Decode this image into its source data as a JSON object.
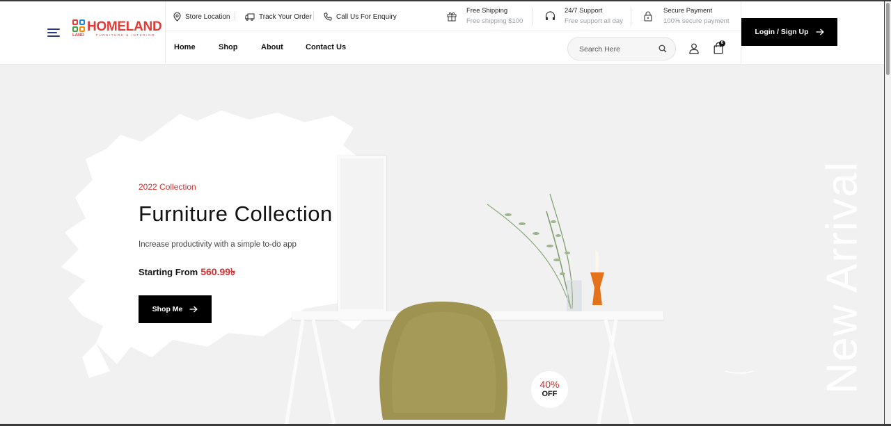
{
  "header": {
    "logo": {
      "name": "HOMELAND",
      "sub": "LAND",
      "tagline": "FURNITURE & INTERIOR"
    },
    "top_links": [
      {
        "label": "Store Location",
        "icon": "location-pin-icon"
      },
      {
        "label": "Track Your Order",
        "icon": "truck-icon"
      },
      {
        "label": "Call Us For Enquiry",
        "icon": "phone-icon"
      }
    ],
    "features": [
      {
        "title": "Free Shipping",
        "sub": "Free shipping $100",
        "icon": "gift-icon"
      },
      {
        "title": "24/7 Support",
        "sub": "Free support all day",
        "icon": "headphones-icon"
      },
      {
        "title": "Secure Payment",
        "sub": "100% secure payment",
        "icon": "lock-icon"
      }
    ],
    "nav": [
      {
        "label": "Home"
      },
      {
        "label": "Shop"
      },
      {
        "label": "About"
      },
      {
        "label": "Contact Us"
      }
    ],
    "search": {
      "placeholder": "Search Here"
    },
    "cart_count": "0",
    "login_label": "Login / Sign Up"
  },
  "hero": {
    "eyebrow": "2022 Collection",
    "title": "Furniture Collection",
    "description": "Increase productivity with a simple to-do app",
    "price_prefix": "Starting From",
    "price": "560.99৳",
    "button_label": "Shop Me",
    "side_text": "New Arrival",
    "badge_pct": "40%",
    "badge_off": "OFF"
  },
  "colors": {
    "accent": "#d32f2f",
    "dark": "#000000",
    "hero_bg": "#f1f1f1"
  }
}
